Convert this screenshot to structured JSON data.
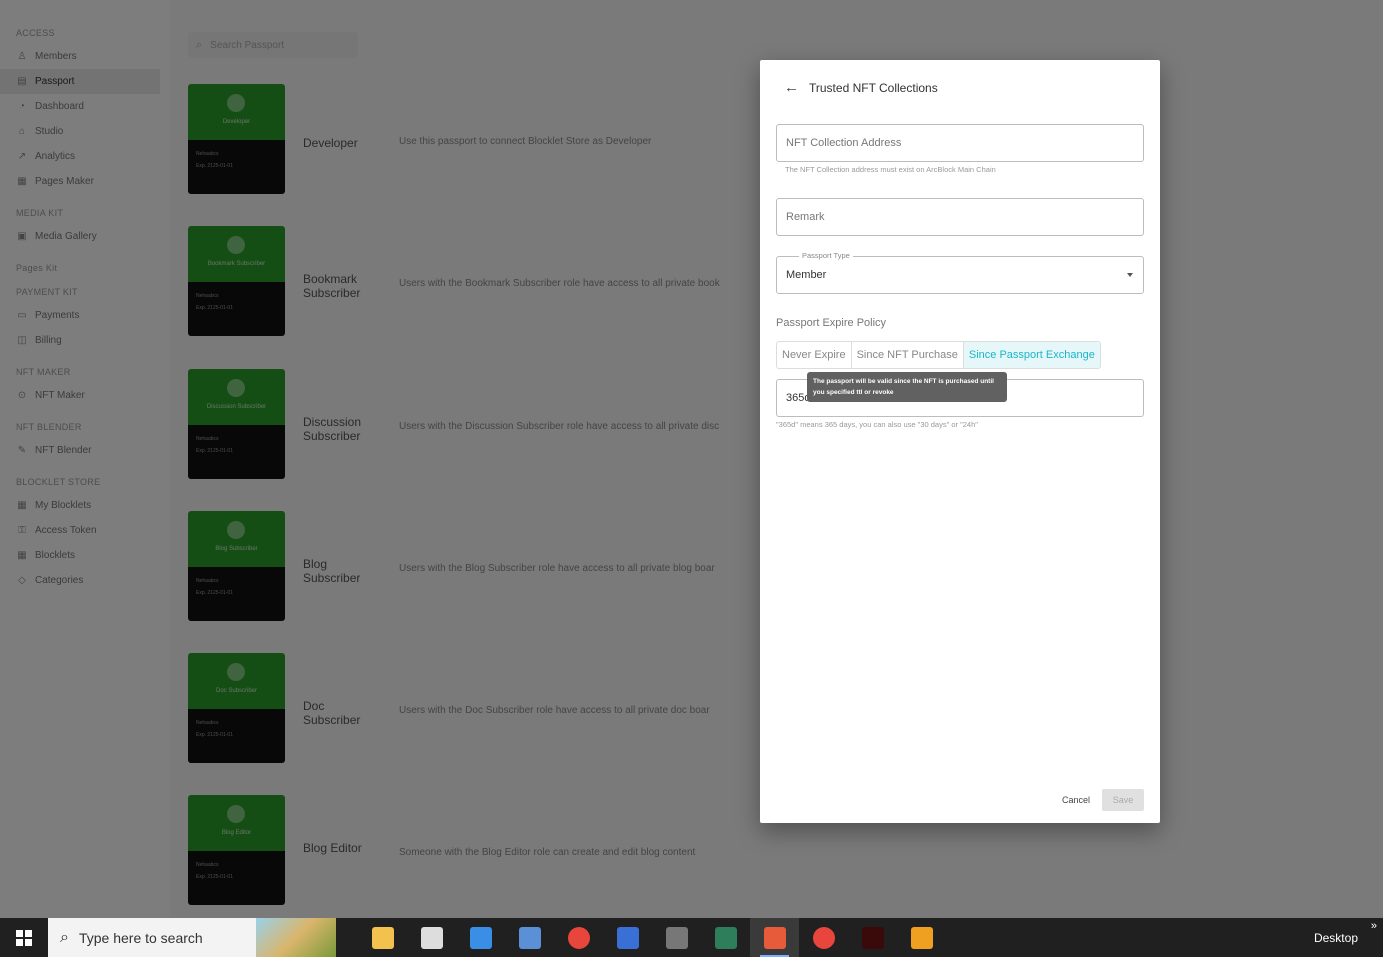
{
  "sidebar": {
    "sections": [
      {
        "title": "ACCESS",
        "items": [
          {
            "label": "Members",
            "icon": "person-icon",
            "active": false
          },
          {
            "label": "Passport",
            "icon": "passport-icon",
            "active": true
          },
          {
            "label": "Dashboard",
            "icon": "dashboard-icon",
            "active": false
          },
          {
            "label": "Studio",
            "icon": "studio-icon",
            "active": false
          },
          {
            "label": "Analytics",
            "icon": "analytics-icon",
            "active": false
          },
          {
            "label": "Pages Maker",
            "icon": "pages-icon",
            "active": false
          }
        ]
      },
      {
        "title": "MEDIA KIT",
        "items": [
          {
            "label": "Media Gallery",
            "icon": "gallery-icon",
            "active": false
          }
        ]
      },
      {
        "title": "Pages Kit",
        "items": []
      },
      {
        "title": "PAYMENT KIT",
        "items": [
          {
            "label": "Payments",
            "icon": "card-icon",
            "active": false
          },
          {
            "label": "Billing",
            "icon": "billing-icon",
            "active": false
          }
        ]
      },
      {
        "title": "NFT MAKER",
        "items": [
          {
            "label": "NFT Maker",
            "icon": "nft-icon",
            "active": false
          }
        ]
      },
      {
        "title": "NFT BLENDER",
        "items": [
          {
            "label": "NFT Blender",
            "icon": "pen-icon",
            "active": false
          }
        ]
      },
      {
        "title": "BLOCKLET STORE",
        "items": [
          {
            "label": "My Blocklets",
            "icon": "grid-icon",
            "active": false
          },
          {
            "label": "Access Token",
            "icon": "key-icon",
            "active": false
          },
          {
            "label": "Blocklets",
            "icon": "grid-icon",
            "active": false
          },
          {
            "label": "Categories",
            "icon": "tag-icon",
            "active": false
          }
        ]
      }
    ]
  },
  "search": {
    "placeholder": "Search Passport"
  },
  "passports": [
    {
      "card_name": "Developer",
      "title": "Developer",
      "desc": "Use this passport to connect Blocklet Store as Developer",
      "card_line1": "Nehaabcs",
      "card_line2": "Exp. 2125-01-01"
    },
    {
      "card_name": "Bookmark Subscriber",
      "title": "Bookmark Subscriber",
      "desc": "Users with the Bookmark Subscriber role have access to all private book",
      "card_line1": "Nehaabcs",
      "card_line2": "Exp. 2125-01-01"
    },
    {
      "card_name": "Discussion Subscriber",
      "title": "Discussion Subscriber",
      "desc": "Users with the Discussion Subscriber role have access to all private disc",
      "card_line1": "Nehaabcs",
      "card_line2": "Exp. 2125-01-01"
    },
    {
      "card_name": "Blog Subscriber",
      "title": "Blog Subscriber",
      "desc": "Users with the Blog Subscriber role have access to all private blog boar",
      "card_line1": "Nehaabcs",
      "card_line2": "Exp. 2125-01-01"
    },
    {
      "card_name": "Doc Subscriber",
      "title": "Doc Subscriber",
      "desc": "Users with the Doc Subscriber role have access to all private doc boar",
      "card_line1": "Nehaabcs",
      "card_line2": "Exp. 2125-01-01"
    },
    {
      "card_name": "Blog Editor",
      "title": "Blog Editor",
      "desc": "Someone with the Blog Editor role can create and edit blog content",
      "card_line1": "Nehaabcs",
      "card_line2": "Exp. 2125-01-01"
    }
  ],
  "dialog": {
    "title": "Trusted NFT Collections",
    "address": {
      "placeholder": "NFT Collection Address",
      "helper": "The NFT Collection address must exist on ArcBlock Main Chain"
    },
    "remark": {
      "placeholder": "Remark"
    },
    "passport_type": {
      "label": "Passport Type",
      "value": "Member"
    },
    "expire_policy": {
      "label": "Passport Expire Policy",
      "options": [
        "Never Expire",
        "Since NFT Purchase",
        "Since Passport Exchange"
      ],
      "selected": "Since Passport Exchange",
      "tooltip": "The passport will be valid since the NFT is purchased until you specified ttl or revoke"
    },
    "ttl": {
      "value": "365d",
      "helper": "\"365d\" means 365 days, you can also use \"30 days\" or \"24h\""
    },
    "cancel_label": "Cancel",
    "save_label": "Save"
  },
  "taskbar": {
    "search_text": "Type here to search",
    "desktop_label": "Desktop",
    "apps": [
      {
        "name": "file-explorer-icon",
        "color": "#f2c14e"
      },
      {
        "name": "app-icon",
        "color": "#dddddd"
      },
      {
        "name": "outlook-icon",
        "color": "#3a8ee6"
      },
      {
        "name": "calculator-icon",
        "color": "#5b8fd6"
      },
      {
        "name": "chrome-icon",
        "color": "#e8453c"
      },
      {
        "name": "app-small-icon",
        "color": "#3a6fd6"
      },
      {
        "name": "amazon-icon",
        "color": "#777777"
      },
      {
        "name": "photo-app-icon",
        "color": "#2e7d5b"
      },
      {
        "name": "active-app-icon",
        "color": "#e85b3a"
      },
      {
        "name": "chrome-profile-icon",
        "color": "#e8453c"
      },
      {
        "name": "illustrator-icon",
        "color": "#3a0a0a"
      },
      {
        "name": "fl-studio-icon",
        "color": "#f0a020"
      }
    ]
  }
}
